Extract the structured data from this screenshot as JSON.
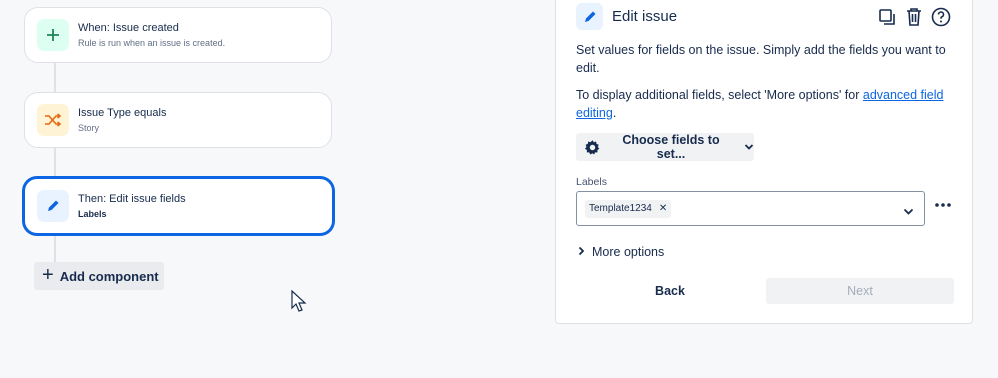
{
  "rule": {
    "trigger": {
      "title": "When: Issue created",
      "subtitle": "Rule is run when an issue is created.",
      "icon": "plus-icon",
      "color": "#1f845a"
    },
    "condition": {
      "title": "Issue Type equals",
      "subtitle": "Story",
      "icon": "shuffle-icon",
      "color": "#e56910"
    },
    "action": {
      "title": "Then: Edit issue fields",
      "subtitle": "Labels",
      "icon": "pencil-icon",
      "color": "#0c66e4"
    },
    "add_component_label": "Add component"
  },
  "panel": {
    "title": "Edit issue",
    "description": "Set values for fields on the issue. Simply add the fields you want to edit.",
    "hint_prefix": "To display additional fields, select 'More options' for ",
    "hint_link": "advanced field editing",
    "hint_suffix": ".",
    "choose_fields_label": "Choose fields to set...",
    "labels_field": {
      "label": "Labels",
      "selected": [
        "Template1234"
      ]
    },
    "more_options_label": "More options",
    "back_label": "Back",
    "next_label": "Next",
    "accent_color": "#0c66e4"
  }
}
